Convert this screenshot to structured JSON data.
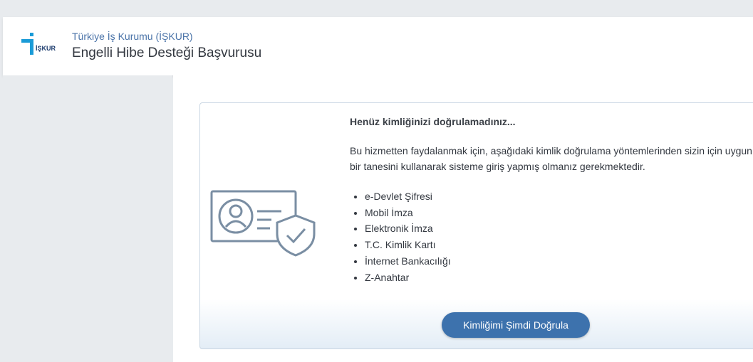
{
  "header": {
    "logo_text": "İŞKUR",
    "organization": "Türkiye İş Kurumu (İŞKUR)",
    "title": "Engelli Hibe Desteği Başvurusu"
  },
  "auth_card": {
    "heading": "Henüz kimliğinizi doğrulamadınız...",
    "description_line1": "Bu hizmetten faydalanmak için, aşağıdaki kimlik doğrulama yöntemlerinden sizin için uygun olan",
    "description_line2": "bir tanesini kullanarak sisteme giriş yapmış olmanız gerekmektedir.",
    "methods": [
      "e-Devlet Şifresi",
      "Mobil İmza",
      "Elektronik İmza",
      "T.C. Kimlik Kartı",
      "İnternet Bankacılığı",
      "Z-Anahtar"
    ],
    "button_label": "Kimliğimi Şimdi Doğrula",
    "illustration_icon": "id-card-shield-icon"
  },
  "colors": {
    "accent": "#3d72ad",
    "logo_blue": "#1a9bd7",
    "logo_dark": "#1d3c6e",
    "illustration": "#7a8ea3"
  }
}
